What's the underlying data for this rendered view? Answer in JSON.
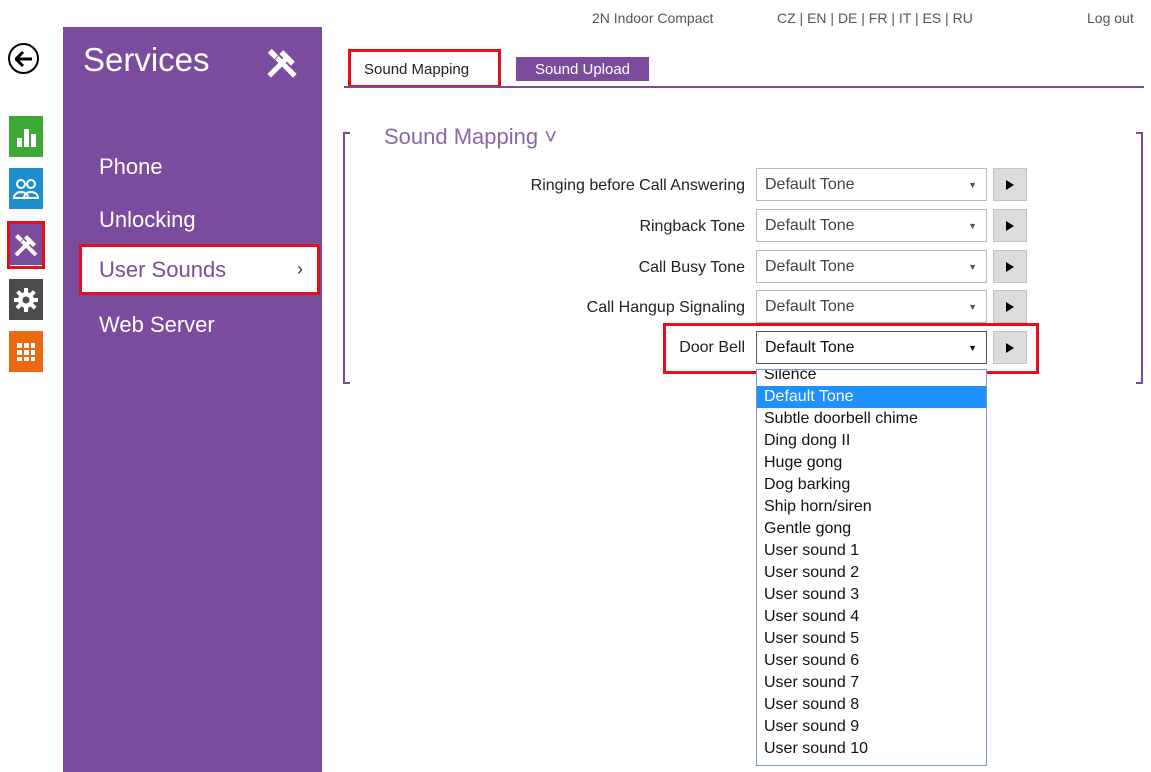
{
  "topbar": {
    "device": "2N Indoor Compact",
    "languages": "CZ | EN | DE | FR | IT | ES | RU",
    "logout": "Log out"
  },
  "rail": {
    "icons": [
      "back-arrow-icon",
      "chart-icon",
      "users-icon",
      "tools-icon",
      "gear-icon",
      "grid-icon"
    ],
    "colors": {
      "chart": "#3ea934",
      "users": "#1d8fcf",
      "tools": "#7b4b9e",
      "gear": "#4b4b4b",
      "grid": "#ea6a12"
    }
  },
  "menu": {
    "title": "Services",
    "items": [
      {
        "label": "Phone"
      },
      {
        "label": "Unlocking"
      },
      {
        "label": "User Sounds",
        "chevron": "›"
      },
      {
        "label": "Web Server"
      }
    ]
  },
  "tabs": [
    {
      "label": "Sound Mapping"
    },
    {
      "label": "Sound Upload"
    }
  ],
  "section": {
    "title": "Sound Mapping ˅"
  },
  "rows": [
    {
      "label": "Ringing before Call Answering",
      "value": "Default Tone"
    },
    {
      "label": "Ringback Tone",
      "value": "Default Tone"
    },
    {
      "label": "Call Busy Tone",
      "value": "Default Tone"
    },
    {
      "label": "Call Hangup Signaling",
      "value": "Default Tone"
    },
    {
      "label": "Door Bell",
      "value": "Default Tone"
    }
  ],
  "dropdown": {
    "selected": "Default Tone",
    "options": [
      "Silence",
      "Default Tone",
      "Subtle doorbell chime",
      "Ding dong II",
      "Huge gong",
      "Dog barking",
      "Ship horn/siren",
      "Gentle gong",
      "User sound 1",
      "User sound 2",
      "User sound 3",
      "User sound 4",
      "User sound 5",
      "User sound 6",
      "User sound 7",
      "User sound 8",
      "User sound 9",
      "User sound 10"
    ]
  },
  "theme": {
    "accent": "#7b4b9e",
    "highlight": "#e3101b",
    "selection": "#1e90ff"
  }
}
